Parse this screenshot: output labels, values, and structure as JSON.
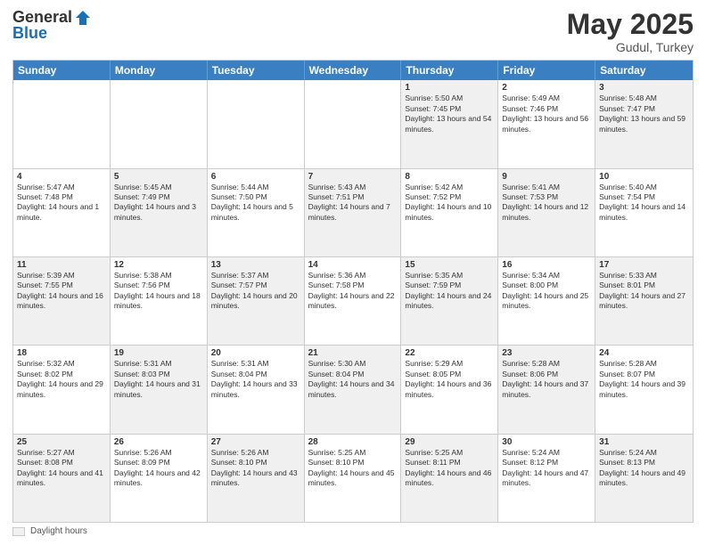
{
  "header": {
    "logo_general": "General",
    "logo_blue": "Blue",
    "title": "May 2025",
    "location": "Gudul, Turkey"
  },
  "days_of_week": [
    "Sunday",
    "Monday",
    "Tuesday",
    "Wednesday",
    "Thursday",
    "Friday",
    "Saturday"
  ],
  "weeks": [
    [
      {
        "day": "",
        "sunrise": "",
        "sunset": "",
        "daylight": "",
        "shaded": false,
        "empty": true
      },
      {
        "day": "",
        "sunrise": "",
        "sunset": "",
        "daylight": "",
        "shaded": false,
        "empty": true
      },
      {
        "day": "",
        "sunrise": "",
        "sunset": "",
        "daylight": "",
        "shaded": false,
        "empty": true
      },
      {
        "day": "",
        "sunrise": "",
        "sunset": "",
        "daylight": "",
        "shaded": false,
        "empty": true
      },
      {
        "day": "1",
        "sunrise": "Sunrise: 5:50 AM",
        "sunset": "Sunset: 7:45 PM",
        "daylight": "Daylight: 13 hours and 54 minutes.",
        "shaded": true,
        "empty": false
      },
      {
        "day": "2",
        "sunrise": "Sunrise: 5:49 AM",
        "sunset": "Sunset: 7:46 PM",
        "daylight": "Daylight: 13 hours and 56 minutes.",
        "shaded": false,
        "empty": false
      },
      {
        "day": "3",
        "sunrise": "Sunrise: 5:48 AM",
        "sunset": "Sunset: 7:47 PM",
        "daylight": "Daylight: 13 hours and 59 minutes.",
        "shaded": true,
        "empty": false
      }
    ],
    [
      {
        "day": "4",
        "sunrise": "Sunrise: 5:47 AM",
        "sunset": "Sunset: 7:48 PM",
        "daylight": "Daylight: 14 hours and 1 minute.",
        "shaded": false,
        "empty": false
      },
      {
        "day": "5",
        "sunrise": "Sunrise: 5:45 AM",
        "sunset": "Sunset: 7:49 PM",
        "daylight": "Daylight: 14 hours and 3 minutes.",
        "shaded": true,
        "empty": false
      },
      {
        "day": "6",
        "sunrise": "Sunrise: 5:44 AM",
        "sunset": "Sunset: 7:50 PM",
        "daylight": "Daylight: 14 hours and 5 minutes.",
        "shaded": false,
        "empty": false
      },
      {
        "day": "7",
        "sunrise": "Sunrise: 5:43 AM",
        "sunset": "Sunset: 7:51 PM",
        "daylight": "Daylight: 14 hours and 7 minutes.",
        "shaded": true,
        "empty": false
      },
      {
        "day": "8",
        "sunrise": "Sunrise: 5:42 AM",
        "sunset": "Sunset: 7:52 PM",
        "daylight": "Daylight: 14 hours and 10 minutes.",
        "shaded": false,
        "empty": false
      },
      {
        "day": "9",
        "sunrise": "Sunrise: 5:41 AM",
        "sunset": "Sunset: 7:53 PM",
        "daylight": "Daylight: 14 hours and 12 minutes.",
        "shaded": true,
        "empty": false
      },
      {
        "day": "10",
        "sunrise": "Sunrise: 5:40 AM",
        "sunset": "Sunset: 7:54 PM",
        "daylight": "Daylight: 14 hours and 14 minutes.",
        "shaded": false,
        "empty": false
      }
    ],
    [
      {
        "day": "11",
        "sunrise": "Sunrise: 5:39 AM",
        "sunset": "Sunset: 7:55 PM",
        "daylight": "Daylight: 14 hours and 16 minutes.",
        "shaded": true,
        "empty": false
      },
      {
        "day": "12",
        "sunrise": "Sunrise: 5:38 AM",
        "sunset": "Sunset: 7:56 PM",
        "daylight": "Daylight: 14 hours and 18 minutes.",
        "shaded": false,
        "empty": false
      },
      {
        "day": "13",
        "sunrise": "Sunrise: 5:37 AM",
        "sunset": "Sunset: 7:57 PM",
        "daylight": "Daylight: 14 hours and 20 minutes.",
        "shaded": true,
        "empty": false
      },
      {
        "day": "14",
        "sunrise": "Sunrise: 5:36 AM",
        "sunset": "Sunset: 7:58 PM",
        "daylight": "Daylight: 14 hours and 22 minutes.",
        "shaded": false,
        "empty": false
      },
      {
        "day": "15",
        "sunrise": "Sunrise: 5:35 AM",
        "sunset": "Sunset: 7:59 PM",
        "daylight": "Daylight: 14 hours and 24 minutes.",
        "shaded": true,
        "empty": false
      },
      {
        "day": "16",
        "sunrise": "Sunrise: 5:34 AM",
        "sunset": "Sunset: 8:00 PM",
        "daylight": "Daylight: 14 hours and 25 minutes.",
        "shaded": false,
        "empty": false
      },
      {
        "day": "17",
        "sunrise": "Sunrise: 5:33 AM",
        "sunset": "Sunset: 8:01 PM",
        "daylight": "Daylight: 14 hours and 27 minutes.",
        "shaded": true,
        "empty": false
      }
    ],
    [
      {
        "day": "18",
        "sunrise": "Sunrise: 5:32 AM",
        "sunset": "Sunset: 8:02 PM",
        "daylight": "Daylight: 14 hours and 29 minutes.",
        "shaded": false,
        "empty": false
      },
      {
        "day": "19",
        "sunrise": "Sunrise: 5:31 AM",
        "sunset": "Sunset: 8:03 PM",
        "daylight": "Daylight: 14 hours and 31 minutes.",
        "shaded": true,
        "empty": false
      },
      {
        "day": "20",
        "sunrise": "Sunrise: 5:31 AM",
        "sunset": "Sunset: 8:04 PM",
        "daylight": "Daylight: 14 hours and 33 minutes.",
        "shaded": false,
        "empty": false
      },
      {
        "day": "21",
        "sunrise": "Sunrise: 5:30 AM",
        "sunset": "Sunset: 8:04 PM",
        "daylight": "Daylight: 14 hours and 34 minutes.",
        "shaded": true,
        "empty": false
      },
      {
        "day": "22",
        "sunrise": "Sunrise: 5:29 AM",
        "sunset": "Sunset: 8:05 PM",
        "daylight": "Daylight: 14 hours and 36 minutes.",
        "shaded": false,
        "empty": false
      },
      {
        "day": "23",
        "sunrise": "Sunrise: 5:28 AM",
        "sunset": "Sunset: 8:06 PM",
        "daylight": "Daylight: 14 hours and 37 minutes.",
        "shaded": true,
        "empty": false
      },
      {
        "day": "24",
        "sunrise": "Sunrise: 5:28 AM",
        "sunset": "Sunset: 8:07 PM",
        "daylight": "Daylight: 14 hours and 39 minutes.",
        "shaded": false,
        "empty": false
      }
    ],
    [
      {
        "day": "25",
        "sunrise": "Sunrise: 5:27 AM",
        "sunset": "Sunset: 8:08 PM",
        "daylight": "Daylight: 14 hours and 41 minutes.",
        "shaded": true,
        "empty": false
      },
      {
        "day": "26",
        "sunrise": "Sunrise: 5:26 AM",
        "sunset": "Sunset: 8:09 PM",
        "daylight": "Daylight: 14 hours and 42 minutes.",
        "shaded": false,
        "empty": false
      },
      {
        "day": "27",
        "sunrise": "Sunrise: 5:26 AM",
        "sunset": "Sunset: 8:10 PM",
        "daylight": "Daylight: 14 hours and 43 minutes.",
        "shaded": true,
        "empty": false
      },
      {
        "day": "28",
        "sunrise": "Sunrise: 5:25 AM",
        "sunset": "Sunset: 8:10 PM",
        "daylight": "Daylight: 14 hours and 45 minutes.",
        "shaded": false,
        "empty": false
      },
      {
        "day": "29",
        "sunrise": "Sunrise: 5:25 AM",
        "sunset": "Sunset: 8:11 PM",
        "daylight": "Daylight: 14 hours and 46 minutes.",
        "shaded": true,
        "empty": false
      },
      {
        "day": "30",
        "sunrise": "Sunrise: 5:24 AM",
        "sunset": "Sunset: 8:12 PM",
        "daylight": "Daylight: 14 hours and 47 minutes.",
        "shaded": false,
        "empty": false
      },
      {
        "day": "31",
        "sunrise": "Sunrise: 5:24 AM",
        "sunset": "Sunset: 8:13 PM",
        "daylight": "Daylight: 14 hours and 49 minutes.",
        "shaded": true,
        "empty": false
      }
    ]
  ],
  "footer": {
    "label": "Daylight hours"
  }
}
